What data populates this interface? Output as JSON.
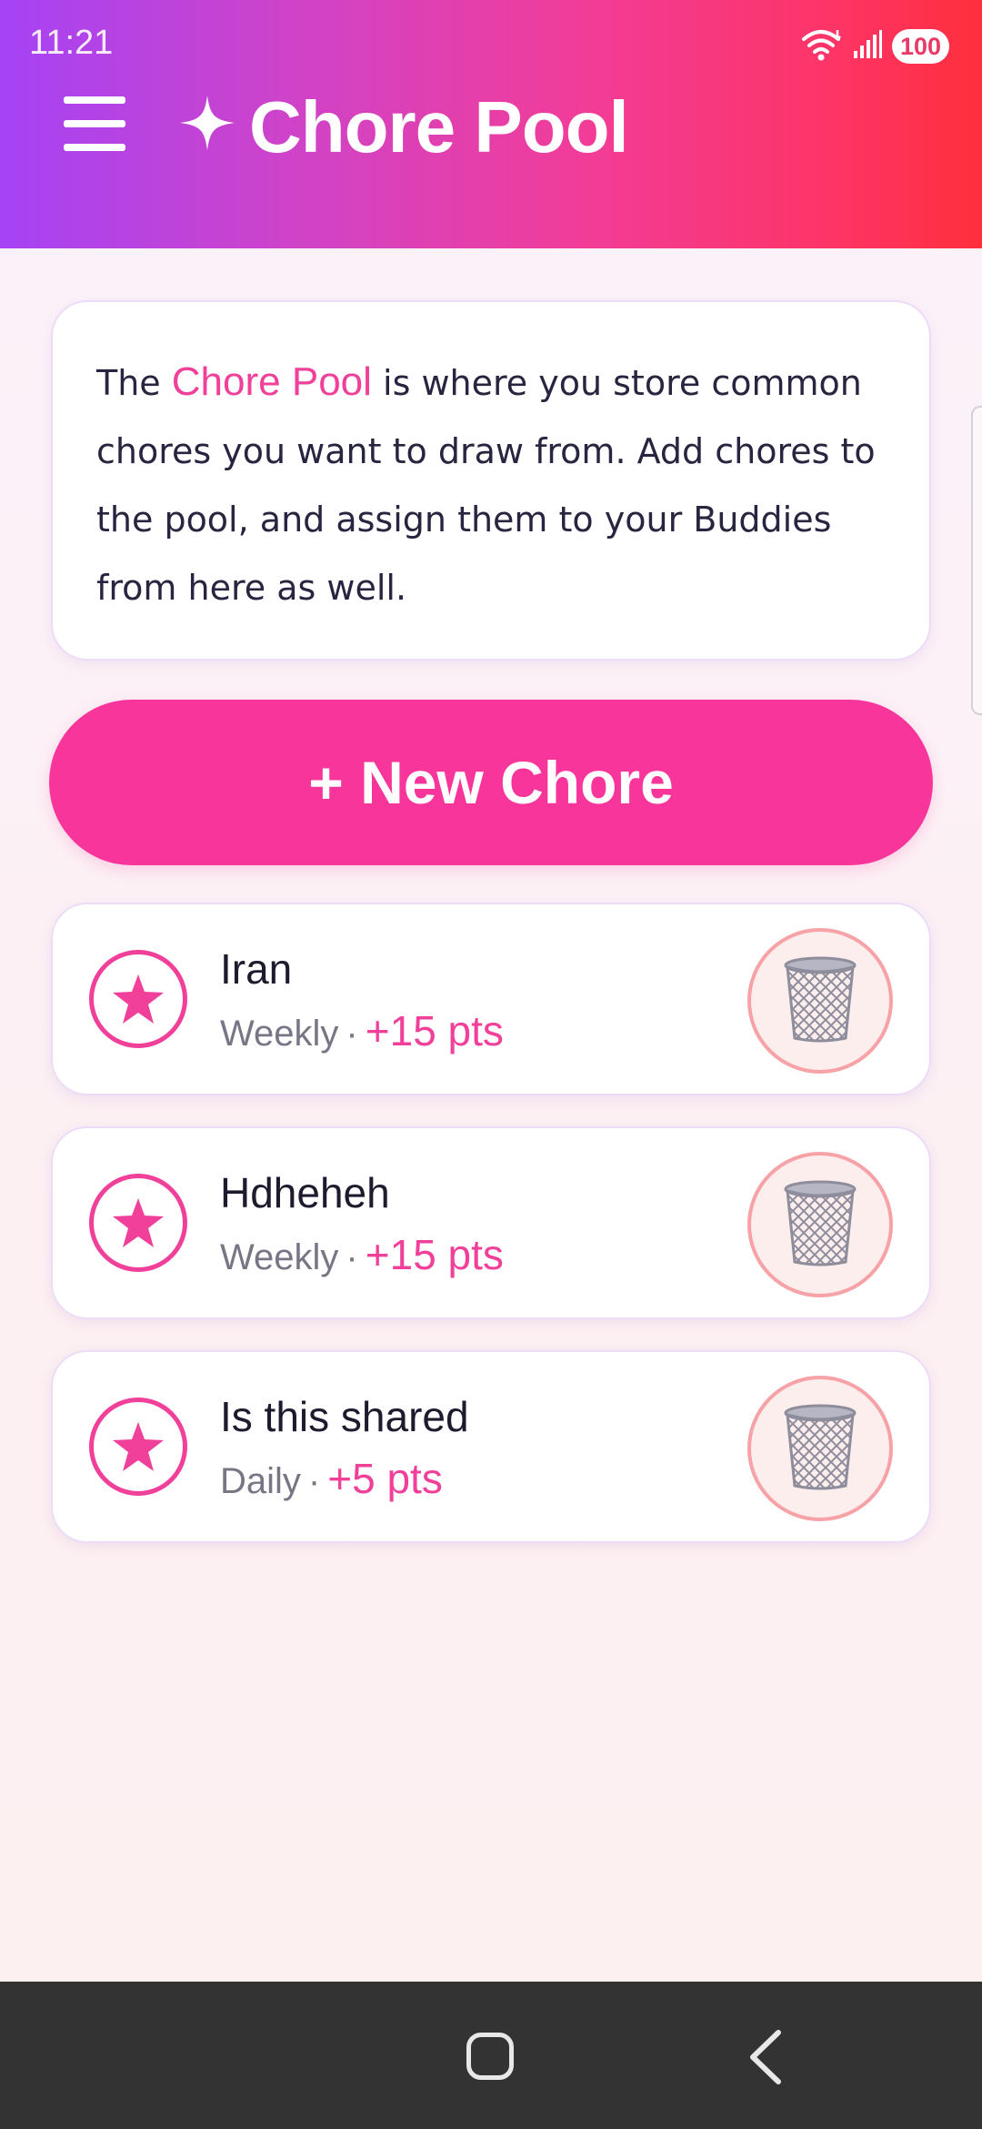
{
  "status_bar": {
    "time": "11:21",
    "battery": "100",
    "icons": [
      "wifi-icon",
      "signal-icon",
      "battery-icon"
    ]
  },
  "header": {
    "menu_icon": "hamburger-icon",
    "title_icon": "sparkle-icon",
    "title": "Chore Pool",
    "gradient": [
      "#a543f5",
      "#f23c97",
      "#ff2f3d"
    ]
  },
  "info": {
    "prefix": "The",
    "highlight": "Chore Pool",
    "text": "is where you store common chores you want to draw from. Add chores to the pool, and assign them to your Buddies from here as well."
  },
  "new_chore_button": {
    "label": "+ New Chore",
    "color": "#f8359a"
  },
  "chores": [
    {
      "name": "Iran",
      "frequency": "Weekly",
      "separator": "·",
      "points": "+15 pts",
      "icon": "star-icon",
      "action_icon": "trash-icon"
    },
    {
      "name": "Hdheheh",
      "frequency": "Weekly",
      "separator": "·",
      "points": "+15 pts",
      "icon": "star-icon",
      "action_icon": "trash-icon"
    },
    {
      "name": "Is this shared",
      "frequency": "Daily",
      "separator": "·",
      "points": "+5 pts",
      "icon": "star-icon",
      "action_icon": "trash-icon"
    }
  ],
  "accent_color": "#f0409a",
  "nav_bar": {
    "icons": [
      "home-icon",
      "back-icon"
    ]
  }
}
